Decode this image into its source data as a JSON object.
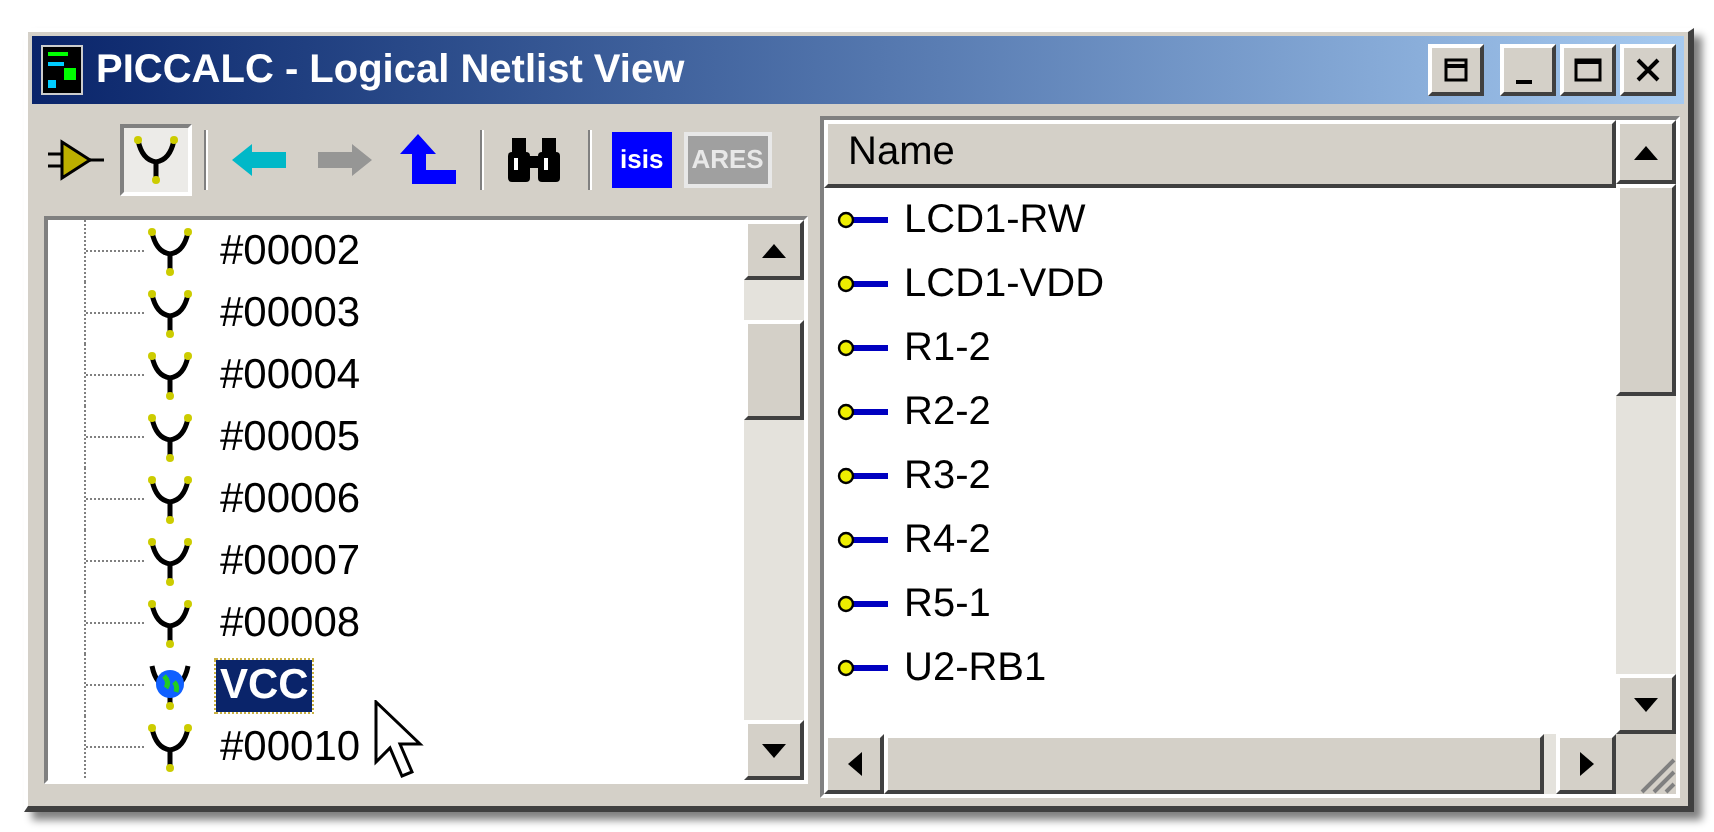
{
  "window": {
    "title": "PICCALC - Logical Netlist View"
  },
  "title_buttons": [
    {
      "kind": "restore"
    },
    {
      "kind": "minimize"
    },
    {
      "kind": "maximize"
    },
    {
      "kind": "close"
    }
  ],
  "toolbar": [
    {
      "kind": "pin",
      "selected": false,
      "disabled": false
    },
    {
      "kind": "net",
      "selected": true,
      "disabled": false
    },
    {
      "kind": "separator"
    },
    {
      "kind": "back",
      "selected": false,
      "disabled": false
    },
    {
      "kind": "forward",
      "selected": false,
      "disabled": true
    },
    {
      "kind": "up",
      "selected": false,
      "disabled": false
    },
    {
      "kind": "separator"
    },
    {
      "kind": "find",
      "selected": false,
      "disabled": false
    },
    {
      "kind": "separator"
    },
    {
      "kind": "logo",
      "label": "isis",
      "selected": false,
      "disabled": false
    },
    {
      "kind": "logo",
      "label": "ARES",
      "selected": false,
      "disabled": true
    }
  ],
  "tree": {
    "items": [
      {
        "kind": "net",
        "label": "#00002",
        "selected": false
      },
      {
        "kind": "net",
        "label": "#00003",
        "selected": false
      },
      {
        "kind": "net",
        "label": "#00004",
        "selected": false
      },
      {
        "kind": "net",
        "label": "#00005",
        "selected": false
      },
      {
        "kind": "net",
        "label": "#00006",
        "selected": false
      },
      {
        "kind": "net",
        "label": "#00007",
        "selected": false
      },
      {
        "kind": "net",
        "label": "#00008",
        "selected": false
      },
      {
        "kind": "global",
        "label": "VCC",
        "selected": true
      },
      {
        "kind": "net",
        "label": "#00010",
        "selected": false
      }
    ]
  },
  "list": {
    "columns": [
      "Name"
    ],
    "rows": [
      {
        "name": "LCD1-RW"
      },
      {
        "name": "LCD1-VDD"
      },
      {
        "name": "R1-2"
      },
      {
        "name": "R2-2"
      },
      {
        "name": "R3-2"
      },
      {
        "name": "R4-2"
      },
      {
        "name": "R5-1"
      },
      {
        "name": "U2-RB1"
      }
    ]
  }
}
